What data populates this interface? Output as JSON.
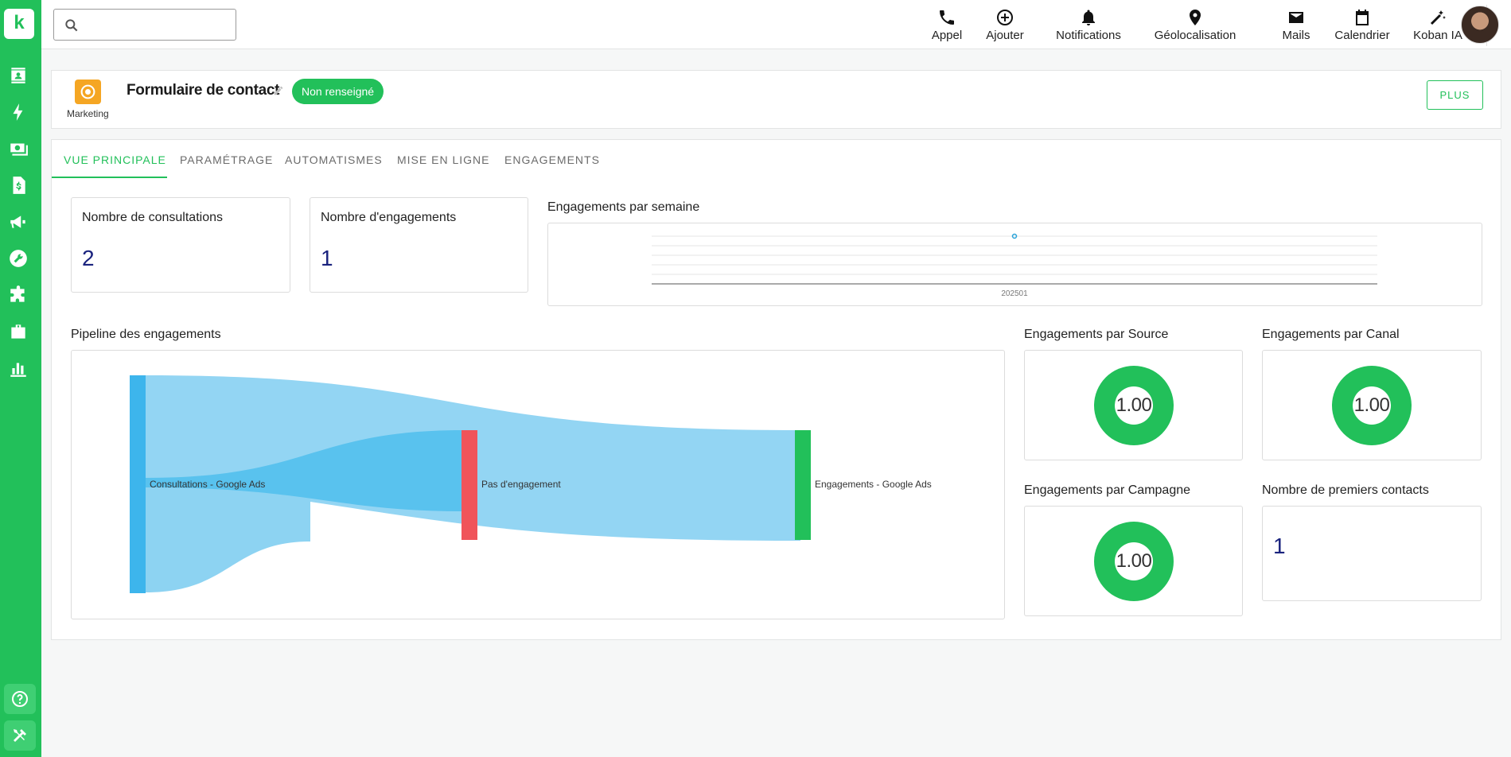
{
  "sidebar": {
    "logo": "k",
    "items": [
      {
        "icon": "contacts-icon"
      },
      {
        "icon": "lightning-icon"
      },
      {
        "icon": "money-icon"
      },
      {
        "icon": "invoice-icon"
      },
      {
        "icon": "megaphone-icon"
      },
      {
        "icon": "wrench-icon"
      },
      {
        "icon": "puzzle-icon"
      },
      {
        "icon": "briefcase-icon"
      },
      {
        "icon": "chart-icon"
      }
    ],
    "bottom": [
      {
        "icon": "help-icon"
      },
      {
        "icon": "tools-icon"
      }
    ]
  },
  "header": {
    "search": {
      "value": "",
      "placeholder": ""
    },
    "nav": [
      {
        "label": "Appel",
        "icon": "phone-icon"
      },
      {
        "label": "Ajouter",
        "icon": "add-circle-icon"
      },
      {
        "label": "Notifications",
        "icon": "bell-icon"
      },
      {
        "label": "Géolocalisation",
        "icon": "location-pin-icon"
      },
      {
        "label": "Mails",
        "icon": "mail-icon"
      },
      {
        "label": "Calendrier",
        "icon": "calendar-icon"
      },
      {
        "label": "Koban IA",
        "icon": "magic-wand-icon"
      }
    ]
  },
  "form": {
    "category": "Marketing",
    "title": "Formulaire de contact",
    "status": "Non renseigné",
    "more_button": "PLUS"
  },
  "tabs": [
    {
      "label": "VUE PRINCIPALE",
      "active": true
    },
    {
      "label": "PARAMÉTRAGE",
      "active": false
    },
    {
      "label": "AUTOMATISMES",
      "active": false
    },
    {
      "label": "MISE EN LIGNE",
      "active": false
    },
    {
      "label": "ENGAGEMENTS",
      "active": false
    }
  ],
  "kpis": {
    "consultations": {
      "label": "Nombre de consultations",
      "value": "2"
    },
    "engagements": {
      "label": "Nombre d'engagements",
      "value": "1"
    },
    "premiers_contacts": {
      "label": "Nombre de premiers contacts",
      "value": "1"
    }
  },
  "weekly": {
    "title": "Engagements par semaine",
    "x_label": "202501"
  },
  "pipeline": {
    "title": "Pipeline des engagements",
    "nodes": [
      "Consultations - Google Ads",
      "Pas d'engagement",
      "Engagements - Google Ads"
    ],
    "colors": {
      "source": "#3db5ec",
      "none": "#f0545a",
      "engaged": "#22c05a",
      "flow": "#8dd3f2"
    }
  },
  "donuts": {
    "source": {
      "title": "Engagements par Source",
      "value": "1.00"
    },
    "canal": {
      "title": "Engagements par Canal",
      "value": "1.00"
    },
    "campagne": {
      "title": "Engagements par Campagne",
      "value": "1.00"
    }
  },
  "chart_data": {
    "type": "line",
    "title": "Engagements par semaine",
    "x": [
      "202501"
    ],
    "series": [
      {
        "values": [
          1
        ]
      }
    ],
    "grid": true
  }
}
